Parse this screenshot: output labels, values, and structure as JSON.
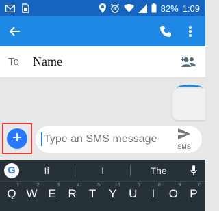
{
  "status_bar": {
    "battery_pct": "82%",
    "time": "1:09",
    "icons": [
      "gmail-icon",
      "sim-icon",
      "location-icon",
      "alarm-icon",
      "wifi-icon",
      "signal-icon",
      "battery-icon"
    ]
  },
  "app_bar": {
    "back_icon": "back-arrow-icon",
    "call_icon": "phone-icon",
    "menu_icon": "more-vert-icon"
  },
  "to_row": {
    "label": "To",
    "value": "Name",
    "add_icon": "add-contact-icon"
  },
  "compose": {
    "placeholder": "Type an SMS message",
    "send_label": "SMS",
    "attach_icon": "plus-icon"
  },
  "keyboard": {
    "suggestions": [
      "If",
      "I",
      "The"
    ],
    "row1": [
      "Q",
      "W",
      "E",
      "R",
      "T",
      "Y",
      "U",
      "I",
      "O",
      "P"
    ],
    "row1_numbers": [
      "1",
      "2",
      "3",
      "4",
      "5",
      "6",
      "7",
      "8",
      "9",
      "0"
    ]
  },
  "colors": {
    "status": "#1565c0",
    "app_bar": "#1e88e5",
    "attach": "#2979ff",
    "highlight": "#e53935",
    "keyboard": "#263238"
  }
}
